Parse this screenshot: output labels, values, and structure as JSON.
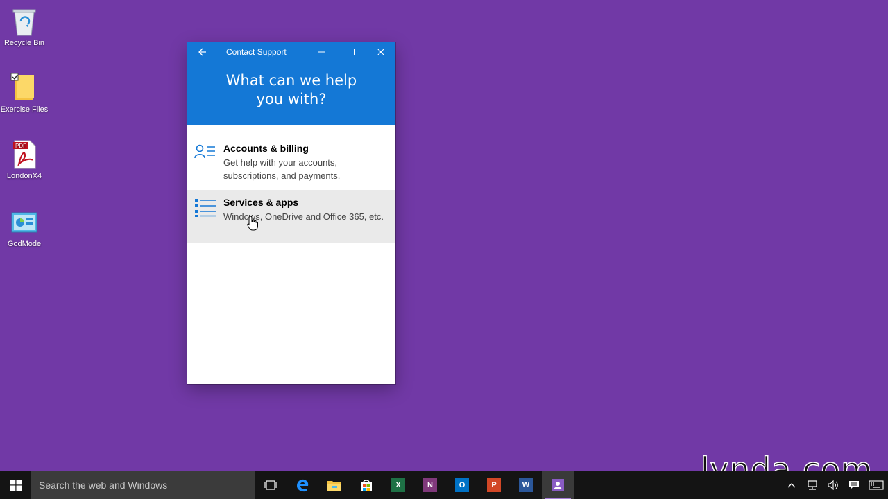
{
  "desktop": {
    "icons": [
      {
        "label": "Recycle Bin"
      },
      {
        "label": "Exercise Files"
      },
      {
        "label": "LondonX4",
        "badge": "PDF"
      },
      {
        "label": "GodMode"
      }
    ]
  },
  "window": {
    "title": "Contact Support",
    "headline": "What can we help you with?",
    "options": [
      {
        "title": "Accounts & billing",
        "description": "Get help with your accounts, subscriptions, and payments.",
        "icon": "person-list-icon"
      },
      {
        "title": "Services & apps",
        "description": "Windows, OneDrive and Office 365, etc.",
        "icon": "bulleted-list-icon"
      }
    ],
    "colors": {
      "header": "#1478d6",
      "hover": "#eaeaea"
    }
  },
  "taskbar": {
    "search_placeholder": "Search the web and Windows",
    "apps": [
      {
        "name": "task-view-icon"
      },
      {
        "name": "edge-icon"
      },
      {
        "name": "file-explorer-icon"
      },
      {
        "name": "store-icon"
      },
      {
        "name": "excel-icon",
        "letter": "X",
        "color": "#1e7145"
      },
      {
        "name": "onenote-icon",
        "letter": "N",
        "color": "#80397b"
      },
      {
        "name": "outlook-icon",
        "letter": "O",
        "color": "#0072c6"
      },
      {
        "name": "powerpoint-icon",
        "letter": "P",
        "color": "#d24726"
      },
      {
        "name": "word-icon",
        "letter": "W",
        "color": "#2b579a"
      },
      {
        "name": "contact-support-icon"
      }
    ]
  },
  "watermark": "lynda.com",
  "colors": {
    "desktop": "#7139a6",
    "taskbar": "#141414"
  }
}
